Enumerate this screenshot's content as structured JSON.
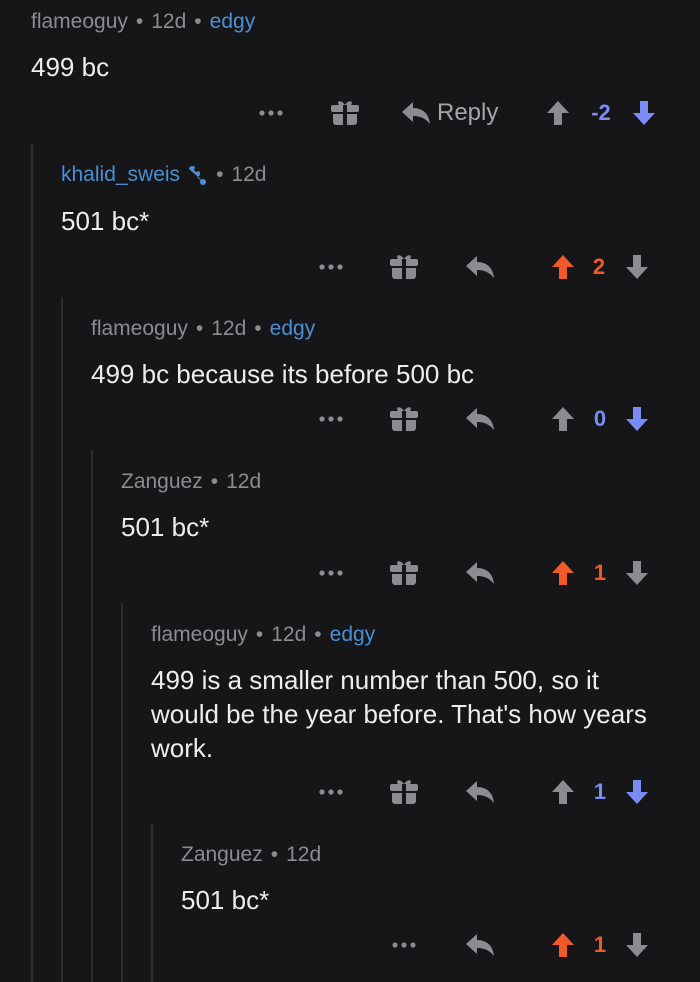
{
  "comments": [
    {
      "author": "flameoguy",
      "age": "12d",
      "flair": "edgy",
      "body": "499 bc",
      "score": "-2",
      "reply_label": "Reply"
    },
    {
      "author": "khalid_sweis",
      "age": "12d",
      "body": "501 bc*",
      "score": "2"
    },
    {
      "author": "flameoguy",
      "age": "12d",
      "flair": "edgy",
      "body": "499 bc because its before 500 bc",
      "score": "0"
    },
    {
      "author": "Zanguez",
      "age": "12d",
      "body": "501 bc*",
      "score": "1"
    },
    {
      "author": "flameoguy",
      "age": "12d",
      "flair": "edgy",
      "body": "499 is a smaller number than 500, so it would be the year before. That's how years work.",
      "score": "1"
    },
    {
      "author": "Zanguez",
      "age": "12d",
      "body": "501 bc*",
      "score": "1"
    }
  ],
  "dot": "•",
  "colors": {
    "background": "#161618",
    "meta": "#8c8c90",
    "flair": "#4a8fd4",
    "upvoted": "#f0592a",
    "downvoted": "#7a8cf5",
    "neutral_icon": "#8c8c90"
  }
}
